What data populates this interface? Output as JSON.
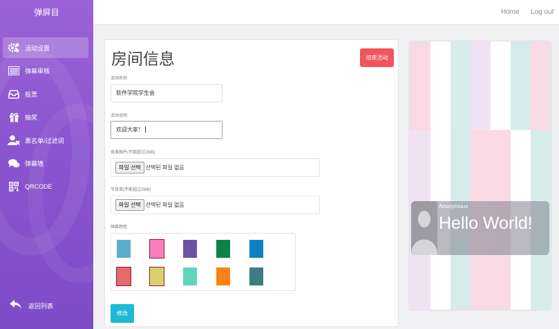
{
  "sidebar": {
    "brand": "弹屏目",
    "items": [
      {
        "label": "活动设置",
        "icon": "gears-icon",
        "active": true
      },
      {
        "label": "弹幕审核",
        "icon": "list-icon",
        "active": false
      },
      {
        "label": "投票",
        "icon": "inbox-icon",
        "active": false
      },
      {
        "label": "抽奖",
        "icon": "gift-icon",
        "active": false
      },
      {
        "label": "黑名单/过滤词",
        "icon": "user-block-icon",
        "active": false
      },
      {
        "label": "弹幕墙",
        "icon": "comments-icon",
        "active": false
      },
      {
        "label": "QRCODE",
        "icon": "qrcode-icon",
        "active": false
      }
    ],
    "back_label": "返回列表"
  },
  "topbar": {
    "home": "Home",
    "logout": "Log out"
  },
  "form": {
    "title": "房间信息",
    "end_button": "结束活动",
    "name_label": "活动名称",
    "name_value": "软件学院学生会",
    "desc_label": "活动说明",
    "desc_value": "欢迎大家！",
    "bg_label": "背景图片(不能超过2MB)",
    "program_label": "节目单(不能超过2MB)",
    "file_button": "파일 선택",
    "file_none": "선택된 파일 없음",
    "color_label": "弹幕颜色",
    "colors": [
      "#5bafc9",
      "#f77ec0",
      "#6b53a6",
      "#0d8248",
      "#0d7fc4",
      "#e36b6b",
      "#d9d06b",
      "#5fd6bb",
      "#fb8313",
      "#3b7d80"
    ],
    "selected_colors": [
      1,
      5,
      6
    ],
    "submit": "修改"
  },
  "preview": {
    "sender": "Anonymous",
    "message": "Hello World!",
    "stripe_colors": [
      "#f9d9e4",
      "#ffffff",
      "#d7ede9",
      "#f1e2f3",
      "#ffffff",
      "#d5ecea",
      "#f9dbe5"
    ]
  }
}
